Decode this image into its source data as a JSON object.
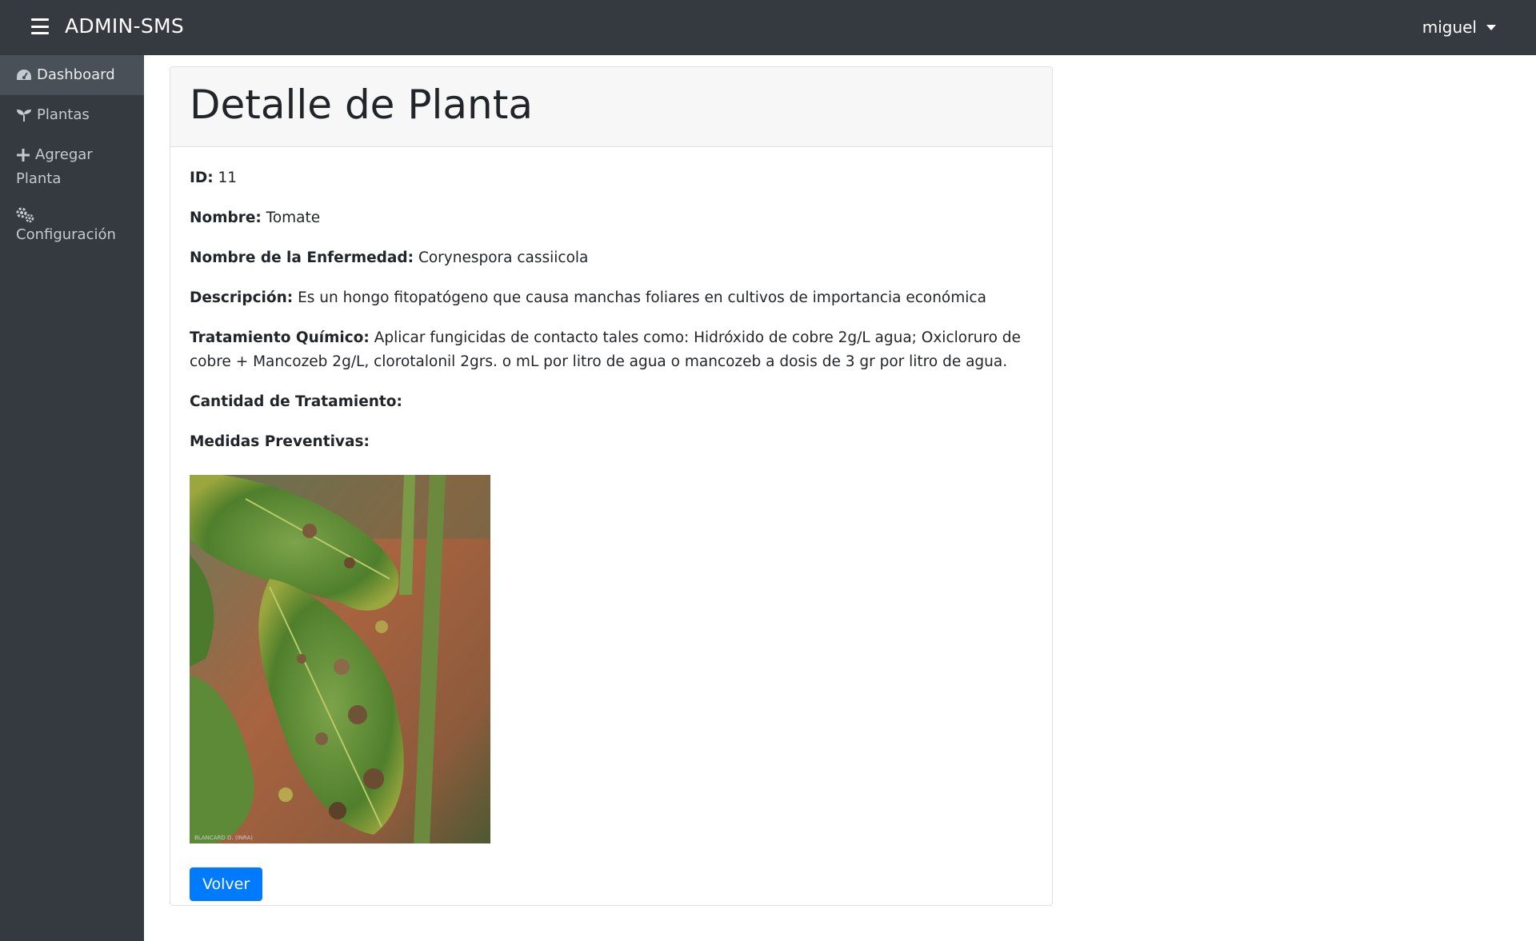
{
  "app": {
    "brand": "ADMIN-SMS",
    "user": "miguel"
  },
  "sidebar": {
    "items": [
      {
        "label": "Dashboard",
        "icon": "tachometer-icon",
        "active": true
      },
      {
        "label": "Plantas",
        "icon": "seedling-icon",
        "active": false
      },
      {
        "label": "Agregar Planta",
        "icon": "plus-icon",
        "active": false
      },
      {
        "label": "Configuración",
        "icon": "cogs-icon",
        "active": false
      }
    ]
  },
  "detail": {
    "title": "Detalle de Planta",
    "fields": [
      {
        "label": "ID:",
        "value": "11"
      },
      {
        "label": "Nombre:",
        "value": "Tomate"
      },
      {
        "label": "Nombre de la Enfermedad:",
        "value": "Corynespora cassiicola"
      },
      {
        "label": "Descripción:",
        "value": "Es un hongo fitopatógeno que causa manchas foliares en cultivos de importancia económica"
      },
      {
        "label": "Tratamiento Químico:",
        "value": "Aplicar fungicidas de contacto tales como: Hidróxido de cobre 2g/L agua; Oxicloruro de cobre + Mancozeb 2g/L, clorotalonil 2grs. o mL por litro de agua o mancozeb a dosis de 3 gr por litro de agua."
      },
      {
        "label": "Cantidad de Tratamiento:",
        "value": ""
      },
      {
        "label": "Medidas Preventivas:",
        "value": ""
      }
    ],
    "image_credit": "BLANCARD D. (INRA)",
    "back_button": "Volver"
  },
  "colors": {
    "topbar": "#343a40",
    "sidebar": "#343a40",
    "active_item": "#495057",
    "primary": "#007bff"
  }
}
